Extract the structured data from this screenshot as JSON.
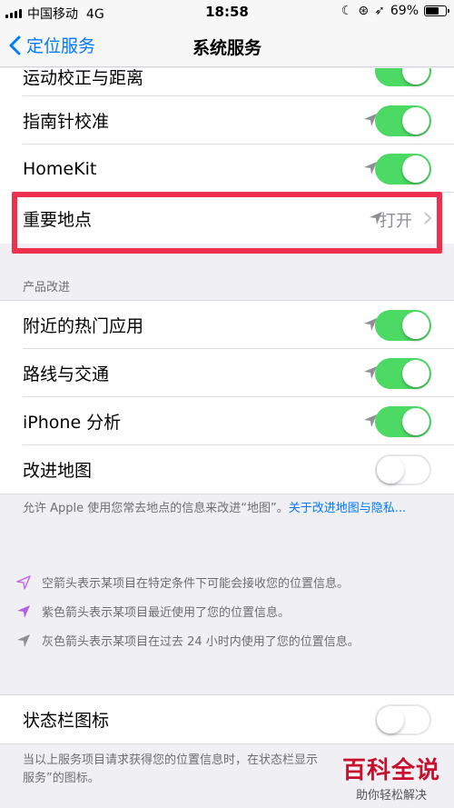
{
  "status_bar": {
    "carrier": "中国移动",
    "network": "4G",
    "time": "18:58",
    "battery": "69%",
    "battery_level": 0.69
  },
  "nav": {
    "back_label": "定位服务",
    "title": "系统服务"
  },
  "top_rows": [
    {
      "label": "运动校正与距离",
      "toggle": "on"
    },
    {
      "label": "指南针校准",
      "toggle": "on"
    },
    {
      "label": "HomeKit",
      "toggle": "on"
    },
    {
      "label": "重要地点",
      "value": "打开"
    }
  ],
  "product_section": {
    "header": "产品改进",
    "rows": [
      {
        "label": "附近的热门应用",
        "toggle": "on"
      },
      {
        "label": "路线与交通",
        "toggle": "on"
      },
      {
        "label": "iPhone 分析",
        "toggle": "on"
      },
      {
        "label": "改进地图",
        "toggle": "off"
      }
    ],
    "footer_text": "允许 Apple 使用您常去地点的信息来改进“地图”。",
    "footer_link": "关于改进地图与隐私..."
  },
  "legend": [
    {
      "icon": "hollow-arrow-icon",
      "color": "#c56cf0",
      "text": "空箭头表示某项目在特定条件下可能会接收您的位置信息。"
    },
    {
      "icon": "purple-arrow-icon",
      "color": "#b45fe0",
      "text": "紫色箭头表示某项目最近使用了您的位置信息。"
    },
    {
      "icon": "gray-arrow-icon",
      "color": "#8e8e93",
      "text": "灰色箭头表示某项目在过去 24 小时内使用了您的位置信息。"
    }
  ],
  "status_icon_row": {
    "label": "状态栏图标",
    "toggle": "off",
    "footer_text": "当以上服务项目请求获得您的位置信息时，在状态栏显示\n服务”的图标。"
  },
  "watermark": {
    "title": "百科全说",
    "subtitle": "助你轻松解决"
  },
  "colors": {
    "accent": "#007aff",
    "toggle_on": "#4cd964",
    "highlight": "#ee2f4d"
  }
}
